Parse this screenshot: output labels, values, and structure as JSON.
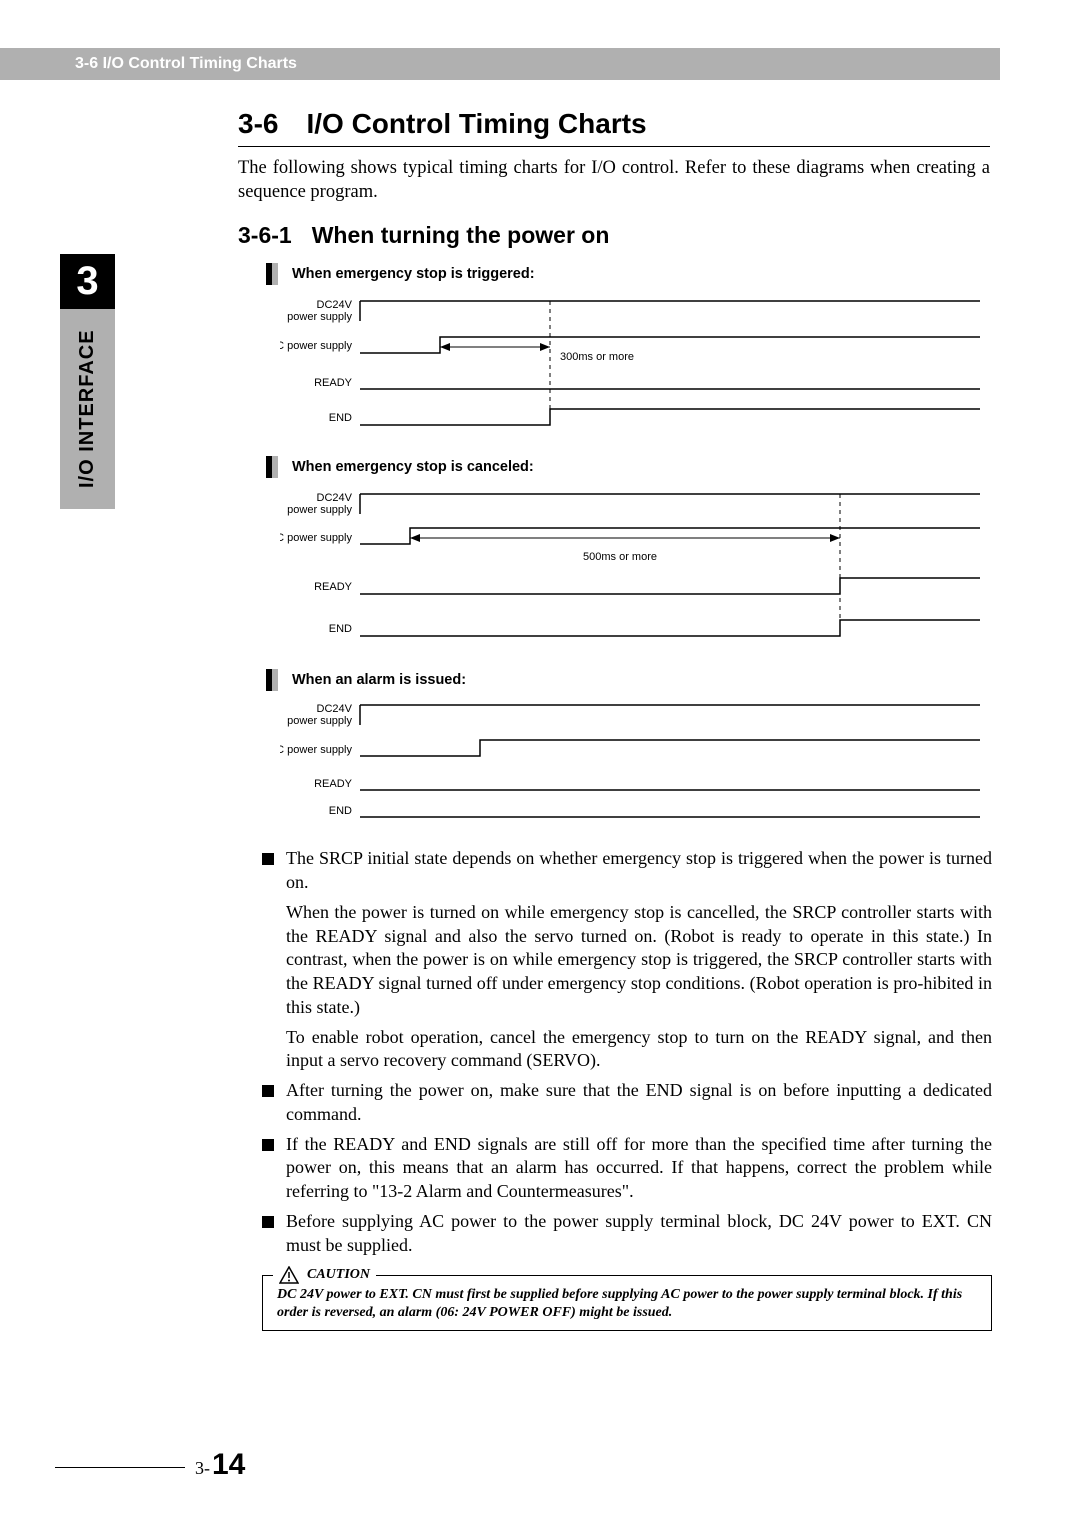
{
  "header": {
    "breadcrumb": "3-6 I/O Control Timing Charts"
  },
  "chapter": {
    "num": "3",
    "label": "I/O INTERFACE"
  },
  "section": {
    "num": "3-6",
    "title": "I/O Control Timing Charts",
    "intro": "The following shows typical timing charts for I/O control. Refer to these diagrams when creating a sequence program."
  },
  "subsection": {
    "num": "3-6-1",
    "title": "When turning the power on"
  },
  "charts": [
    {
      "heading": "When emergency stop is triggered:",
      "signals": [
        "DC24V",
        "power supply",
        "AC power supply",
        "READY",
        "END"
      ],
      "annotation": "300ms or more"
    },
    {
      "heading": "When emergency stop is canceled:",
      "signals": [
        "DC24V",
        "power supply",
        "AC power supply",
        "READY",
        "END"
      ],
      "annotation": "500ms or more"
    },
    {
      "heading": "When an alarm is issued:",
      "signals": [
        "DC24V",
        "power supply",
        "AC power supply",
        "READY",
        "END"
      ],
      "annotation": ""
    }
  ],
  "notes": [
    {
      "lead": "The SRCP initial state depends on whether emergency stop is triggered when the power is turned on.",
      "cont": [
        "When the power is turned on while emergency stop is cancelled, the SRCP controller starts with the READY signal and also the servo turned on. (Robot is ready to operate in this state.) In contrast, when the power is on while emergency stop is triggered, the SRCP controller starts with the READY signal turned off under emergency stop conditions. (Robot operation is pro-hibited in this state.)",
        "To enable robot operation, cancel the emergency stop to turn on the READY signal, and then input a servo recovery command (SERVO)."
      ]
    },
    {
      "lead": "After turning the power on, make sure that the END signal is on before inputting a dedicated command.",
      "cont": []
    },
    {
      "lead": "If the READY and END signals are still off for more than the specified time after turning the power on, this means that an alarm has occurred. If that happens, correct the problem while referring to \"13-2 Alarm and Countermeasures\".",
      "cont": []
    },
    {
      "lead": "Before supplying AC power to the power supply terminal block, DC 24V power to EXT. CN must be supplied.",
      "cont": []
    }
  ],
  "caution": {
    "label": "CAUTION",
    "text": "DC 24V power to EXT. CN must first be supplied before supplying AC power to the power supply terminal block. If this order is reversed, an alarm (06: 24V POWER OFF) might be issued."
  },
  "footer": {
    "chapter": "3-",
    "page": "14"
  },
  "chart_data": [
    {
      "type": "timing",
      "title": "When emergency stop is triggered",
      "signals": [
        {
          "name": "DC24V power supply",
          "transitions": [
            {
              "t": 0,
              "level": "high"
            }
          ]
        },
        {
          "name": "AC power supply",
          "transitions": [
            {
              "t": 0,
              "level": "low"
            },
            {
              "t": 30,
              "level": "high"
            }
          ]
        },
        {
          "name": "READY",
          "transitions": [
            {
              "t": 0,
              "level": "low"
            }
          ]
        },
        {
          "name": "END",
          "transitions": [
            {
              "t": 0,
              "level": "low"
            },
            {
              "t": 60,
              "level": "high"
            }
          ]
        }
      ],
      "annotations": [
        {
          "from": 30,
          "to": 60,
          "label": "300ms or more"
        }
      ]
    },
    {
      "type": "timing",
      "title": "When emergency stop is canceled",
      "signals": [
        {
          "name": "DC24V power supply",
          "transitions": [
            {
              "t": 0,
              "level": "high"
            }
          ]
        },
        {
          "name": "AC power supply",
          "transitions": [
            {
              "t": 0,
              "level": "low"
            },
            {
              "t": 20,
              "level": "high"
            }
          ]
        },
        {
          "name": "READY",
          "transitions": [
            {
              "t": 0,
              "level": "low"
            },
            {
              "t": 85,
              "level": "high"
            }
          ]
        },
        {
          "name": "END",
          "transitions": [
            {
              "t": 0,
              "level": "low"
            },
            {
              "t": 85,
              "level": "high"
            }
          ]
        }
      ],
      "annotations": [
        {
          "from": 20,
          "to": 85,
          "label": "500ms or more"
        }
      ]
    },
    {
      "type": "timing",
      "title": "When an alarm is issued",
      "signals": [
        {
          "name": "DC24V power supply",
          "transitions": [
            {
              "t": 0,
              "level": "high"
            }
          ]
        },
        {
          "name": "AC power supply",
          "transitions": [
            {
              "t": 0,
              "level": "low"
            },
            {
              "t": 35,
              "level": "high"
            }
          ]
        },
        {
          "name": "READY",
          "transitions": [
            {
              "t": 0,
              "level": "low"
            }
          ]
        },
        {
          "name": "END",
          "transitions": [
            {
              "t": 0,
              "level": "low"
            }
          ]
        }
      ],
      "annotations": []
    }
  ]
}
